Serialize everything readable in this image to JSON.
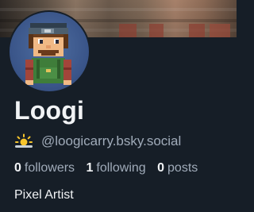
{
  "profile": {
    "display_name": "Loogi",
    "handle": "@loogicarry.bsky.social",
    "bio": "Pixel Artist",
    "emoji": "sun-behind-cloud"
  },
  "stats": {
    "followers_count": "0",
    "followers_label": "followers",
    "following_count": "1",
    "following_label": "following",
    "posts_count": "0",
    "posts_label": "posts"
  },
  "colors": {
    "background": "#161e27",
    "text_primary": "#f1f3f5",
    "text_secondary": "#a0abb9",
    "avatar_bg": "#3a5589"
  }
}
